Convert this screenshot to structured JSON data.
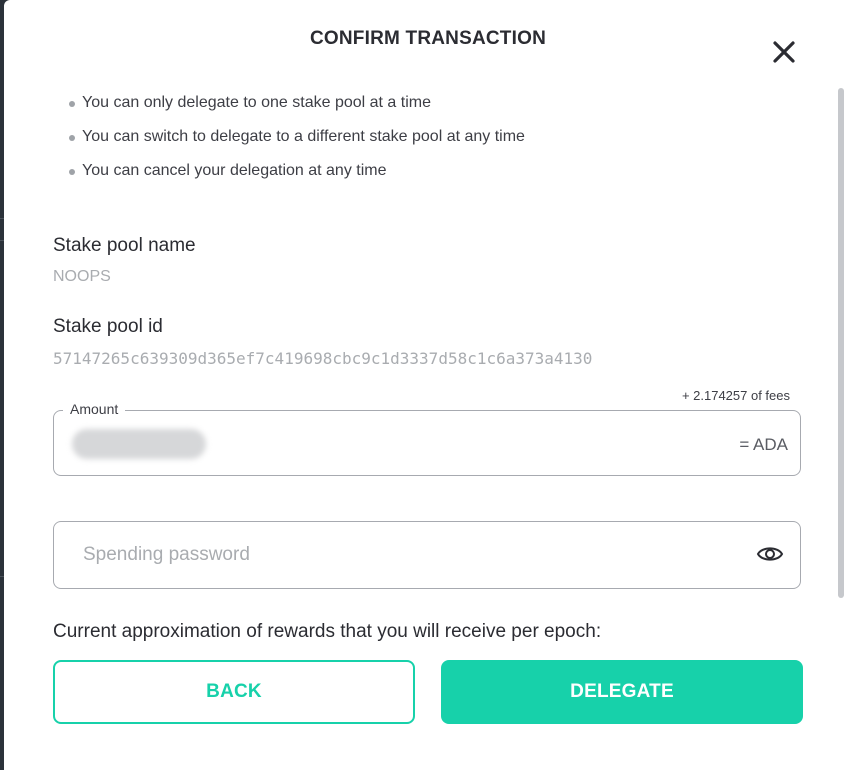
{
  "dialog": {
    "title": "CONFIRM TRANSACTION"
  },
  "info_bullets": [
    "You can only delegate to one stake pool at a time",
    "You can switch to delegate to a different stake pool at any time",
    "You can cancel your delegation at any time"
  ],
  "stake_pool": {
    "name_label": "Stake pool name",
    "name_value": "NOOPS",
    "id_label": "Stake pool id",
    "id_value": "57147265c639309d365ef7c419698cbc9c1d3337d58c1c6a373a4130"
  },
  "amount": {
    "fees_text": "+ 2.174257 of fees",
    "label": "Amount",
    "suffix": "= ADA"
  },
  "password": {
    "placeholder": "Spending password"
  },
  "rewards_text": "Current approximation of rewards that you will receive per epoch:",
  "buttons": {
    "back": "BACK",
    "delegate": "DELEGATE"
  },
  "colors": {
    "accent": "#17d1aa",
    "text": "#2b2c32",
    "muted": "#a9acb0"
  },
  "icons": {
    "close": "close-icon",
    "visibility": "eye-icon"
  }
}
